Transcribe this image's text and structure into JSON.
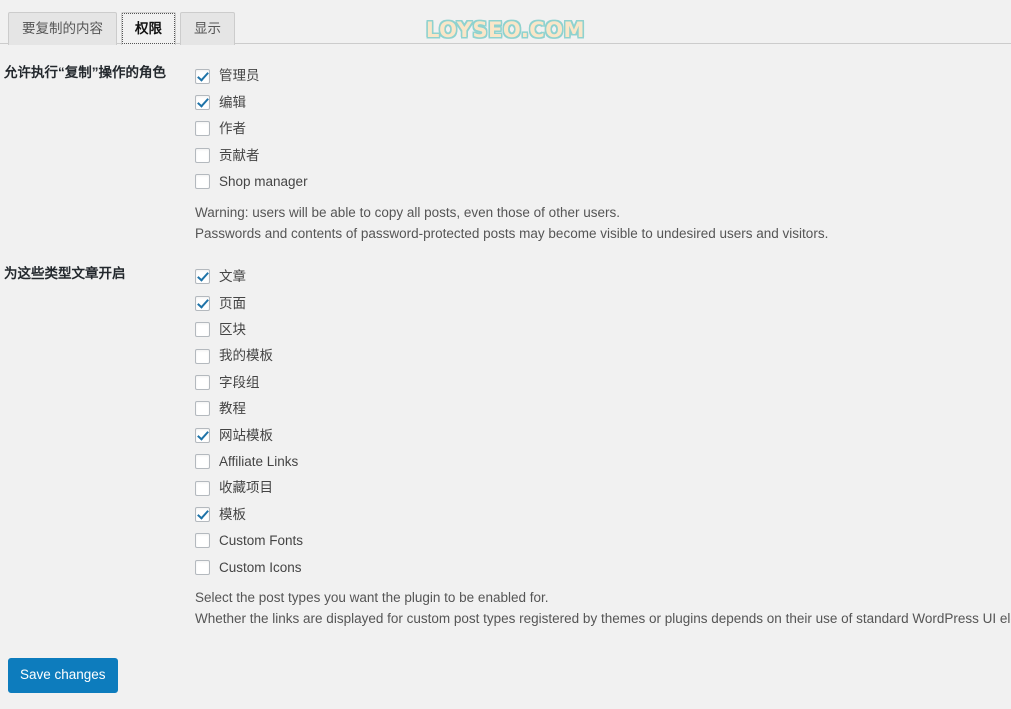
{
  "watermark": {
    "text": "LOYSEO.COM"
  },
  "tabs": [
    {
      "label": "要复制的内容",
      "active": false
    },
    {
      "label": "权限",
      "active": true
    },
    {
      "label": "显示",
      "active": false
    }
  ],
  "sections": [
    {
      "label": "允许执行“复制”操作的角色",
      "options": [
        {
          "label": "管理员",
          "checked": true
        },
        {
          "label": "编辑",
          "checked": true
        },
        {
          "label": "作者",
          "checked": false
        },
        {
          "label": "贡献者",
          "checked": false
        },
        {
          "label": "Shop manager",
          "checked": false
        }
      ],
      "description": [
        "Warning: users will be able to copy all posts, even those of other users.",
        "Passwords and contents of password-protected posts may become visible to undesired users and visitors."
      ]
    },
    {
      "label": "为这些类型文章开启",
      "options": [
        {
          "label": "文章",
          "checked": true
        },
        {
          "label": "页面",
          "checked": true
        },
        {
          "label": "区块",
          "checked": false
        },
        {
          "label": "我的模板",
          "checked": false
        },
        {
          "label": "字段组",
          "checked": false
        },
        {
          "label": "教程",
          "checked": false
        },
        {
          "label": "网站模板",
          "checked": true
        },
        {
          "label": "Affiliate Links",
          "checked": false
        },
        {
          "label": "收藏项目",
          "checked": false
        },
        {
          "label": "模板",
          "checked": true
        },
        {
          "label": "Custom Fonts",
          "checked": false
        },
        {
          "label": "Custom Icons",
          "checked": false
        }
      ],
      "description": [
        "Select the post types you want the plugin to be enabled for.",
        "Whether the links are displayed for custom post types registered by themes or plugins depends on their use of standard WordPress UI elements."
      ]
    }
  ],
  "submit": {
    "label": "Save changes"
  },
  "colors": {
    "accent": "#0d7cbd",
    "checkmark": "#1e73a8",
    "background": "#f1f1f1",
    "watermark_fill": "#fae6c8",
    "watermark_outline": "#8fd2cf"
  }
}
